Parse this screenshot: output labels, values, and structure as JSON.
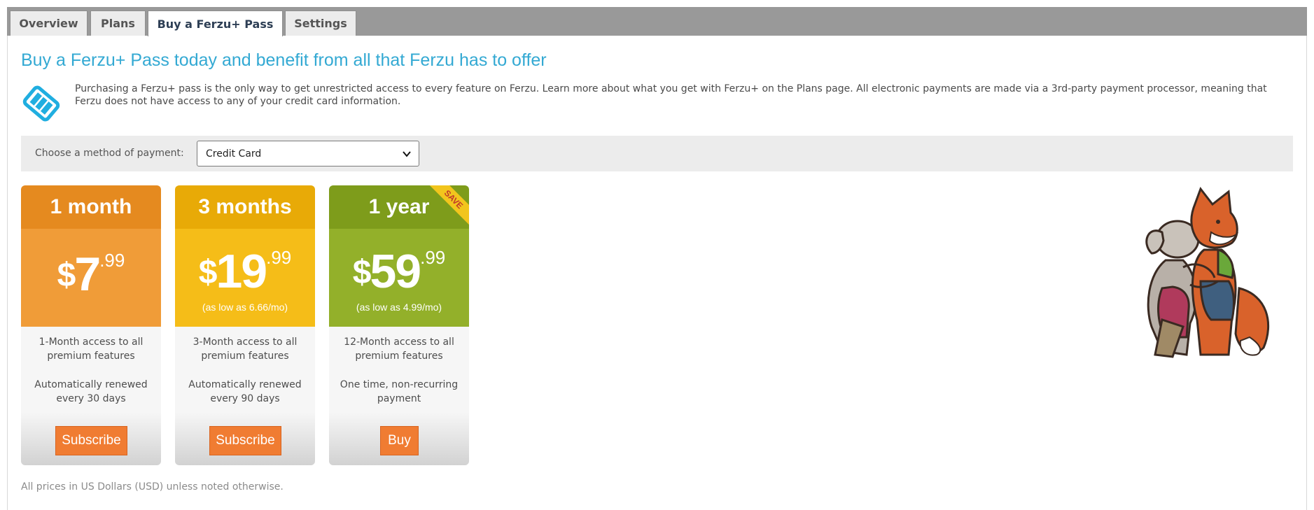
{
  "tabs": [
    {
      "label": "Overview"
    },
    {
      "label": "Plans"
    },
    {
      "label": "Buy a Ferzu+ Pass",
      "active": true
    },
    {
      "label": "Settings"
    }
  ],
  "heading": "Buy a Ferzu+ Pass today and benefit from all that Ferzu has to offer",
  "intro": "Purchasing a Ferzu+ pass is the only way to get unrestricted access to every feature on Ferzu. Learn more about what you get with Ferzu+ on the Plans page. All electronic payments are made via a 3rd-party payment processor, meaning that Ferzu does not have access to any of your credit card information.",
  "payment": {
    "label": "Choose a method of payment:",
    "selected": "Credit Card"
  },
  "plans": [
    {
      "title": "1 month",
      "currency": "$",
      "whole": "7",
      "cents": ".99",
      "per_month": "",
      "access": "1-Month access to all premium features",
      "renewal": "Automatically renewed every 30 days",
      "button": "Subscribe"
    },
    {
      "title": "3 months",
      "currency": "$",
      "whole": "19",
      "cents": ".99",
      "per_month": "(as low as 6.66/mo)",
      "access": "3-Month access to all premium features",
      "renewal": "Automatically renewed every 90 days",
      "button": "Subscribe"
    },
    {
      "title": "1 year",
      "currency": "$",
      "whole": "59",
      "cents": ".99",
      "per_month": "(as low as 4.99/mo)",
      "access": "12-Month access to all premium features",
      "renewal": "One time, non-recurring payment",
      "button": "Buy",
      "ribbon": "SAVE"
    }
  ],
  "footnote": "All prices in US Dollars (USD) unless noted otherwise.",
  "colors": {
    "heading": "#33a9d3",
    "plan1_head": "#e58a1f",
    "plan1_body": "#f09c38",
    "plan2_head": "#e8aa07",
    "plan2_body": "#f5bd18",
    "plan3_head": "#7e9c1b",
    "plan3_body": "#93b02a",
    "button": "#f07c32"
  },
  "icons": {
    "intro": "ticket-icon",
    "mascot": "fox-and-rabbit-mascot"
  }
}
